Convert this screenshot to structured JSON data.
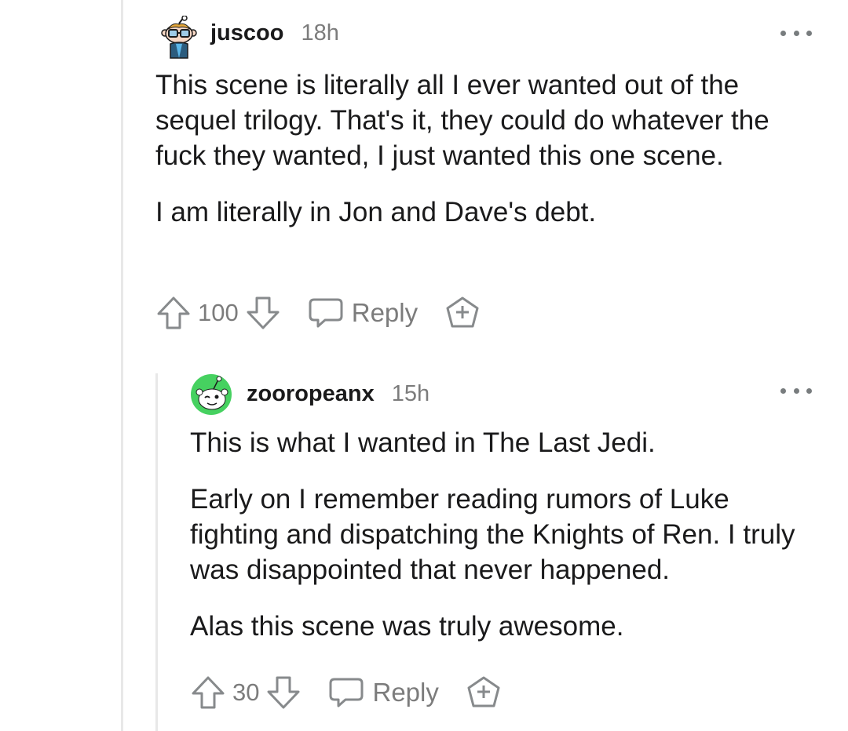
{
  "comment1": {
    "username": "juscoo",
    "time": "18h",
    "paragraphs": [
      "This scene is literally all I ever wanted out of the sequel trilogy. That's it, they could do whatever the fuck they wanted, I just wanted this one scene.",
      "I am literally in Jon and Dave's debt."
    ],
    "score": "100",
    "reply_label": "Reply",
    "avatar_icon": "snoo-glasses-avatar"
  },
  "comment2": {
    "username": "zooropeanx",
    "time": "15h",
    "paragraphs": [
      "This is what I wanted in The Last Jedi.",
      "Early on I remember reading rumors of Luke fighting and dispatching the Knights of Ren. I truly was disappointed that never happened.",
      "Alas this scene was truly awesome."
    ],
    "score": "30",
    "reply_label": "Reply",
    "avatar_icon": "snoo-green-avatar"
  },
  "colors": {
    "text": "#1a1a1b",
    "meta": "#7c7c7c",
    "icon": "#878a8c",
    "thread": "#e8e8e8",
    "avatar_green": "#46d160"
  }
}
